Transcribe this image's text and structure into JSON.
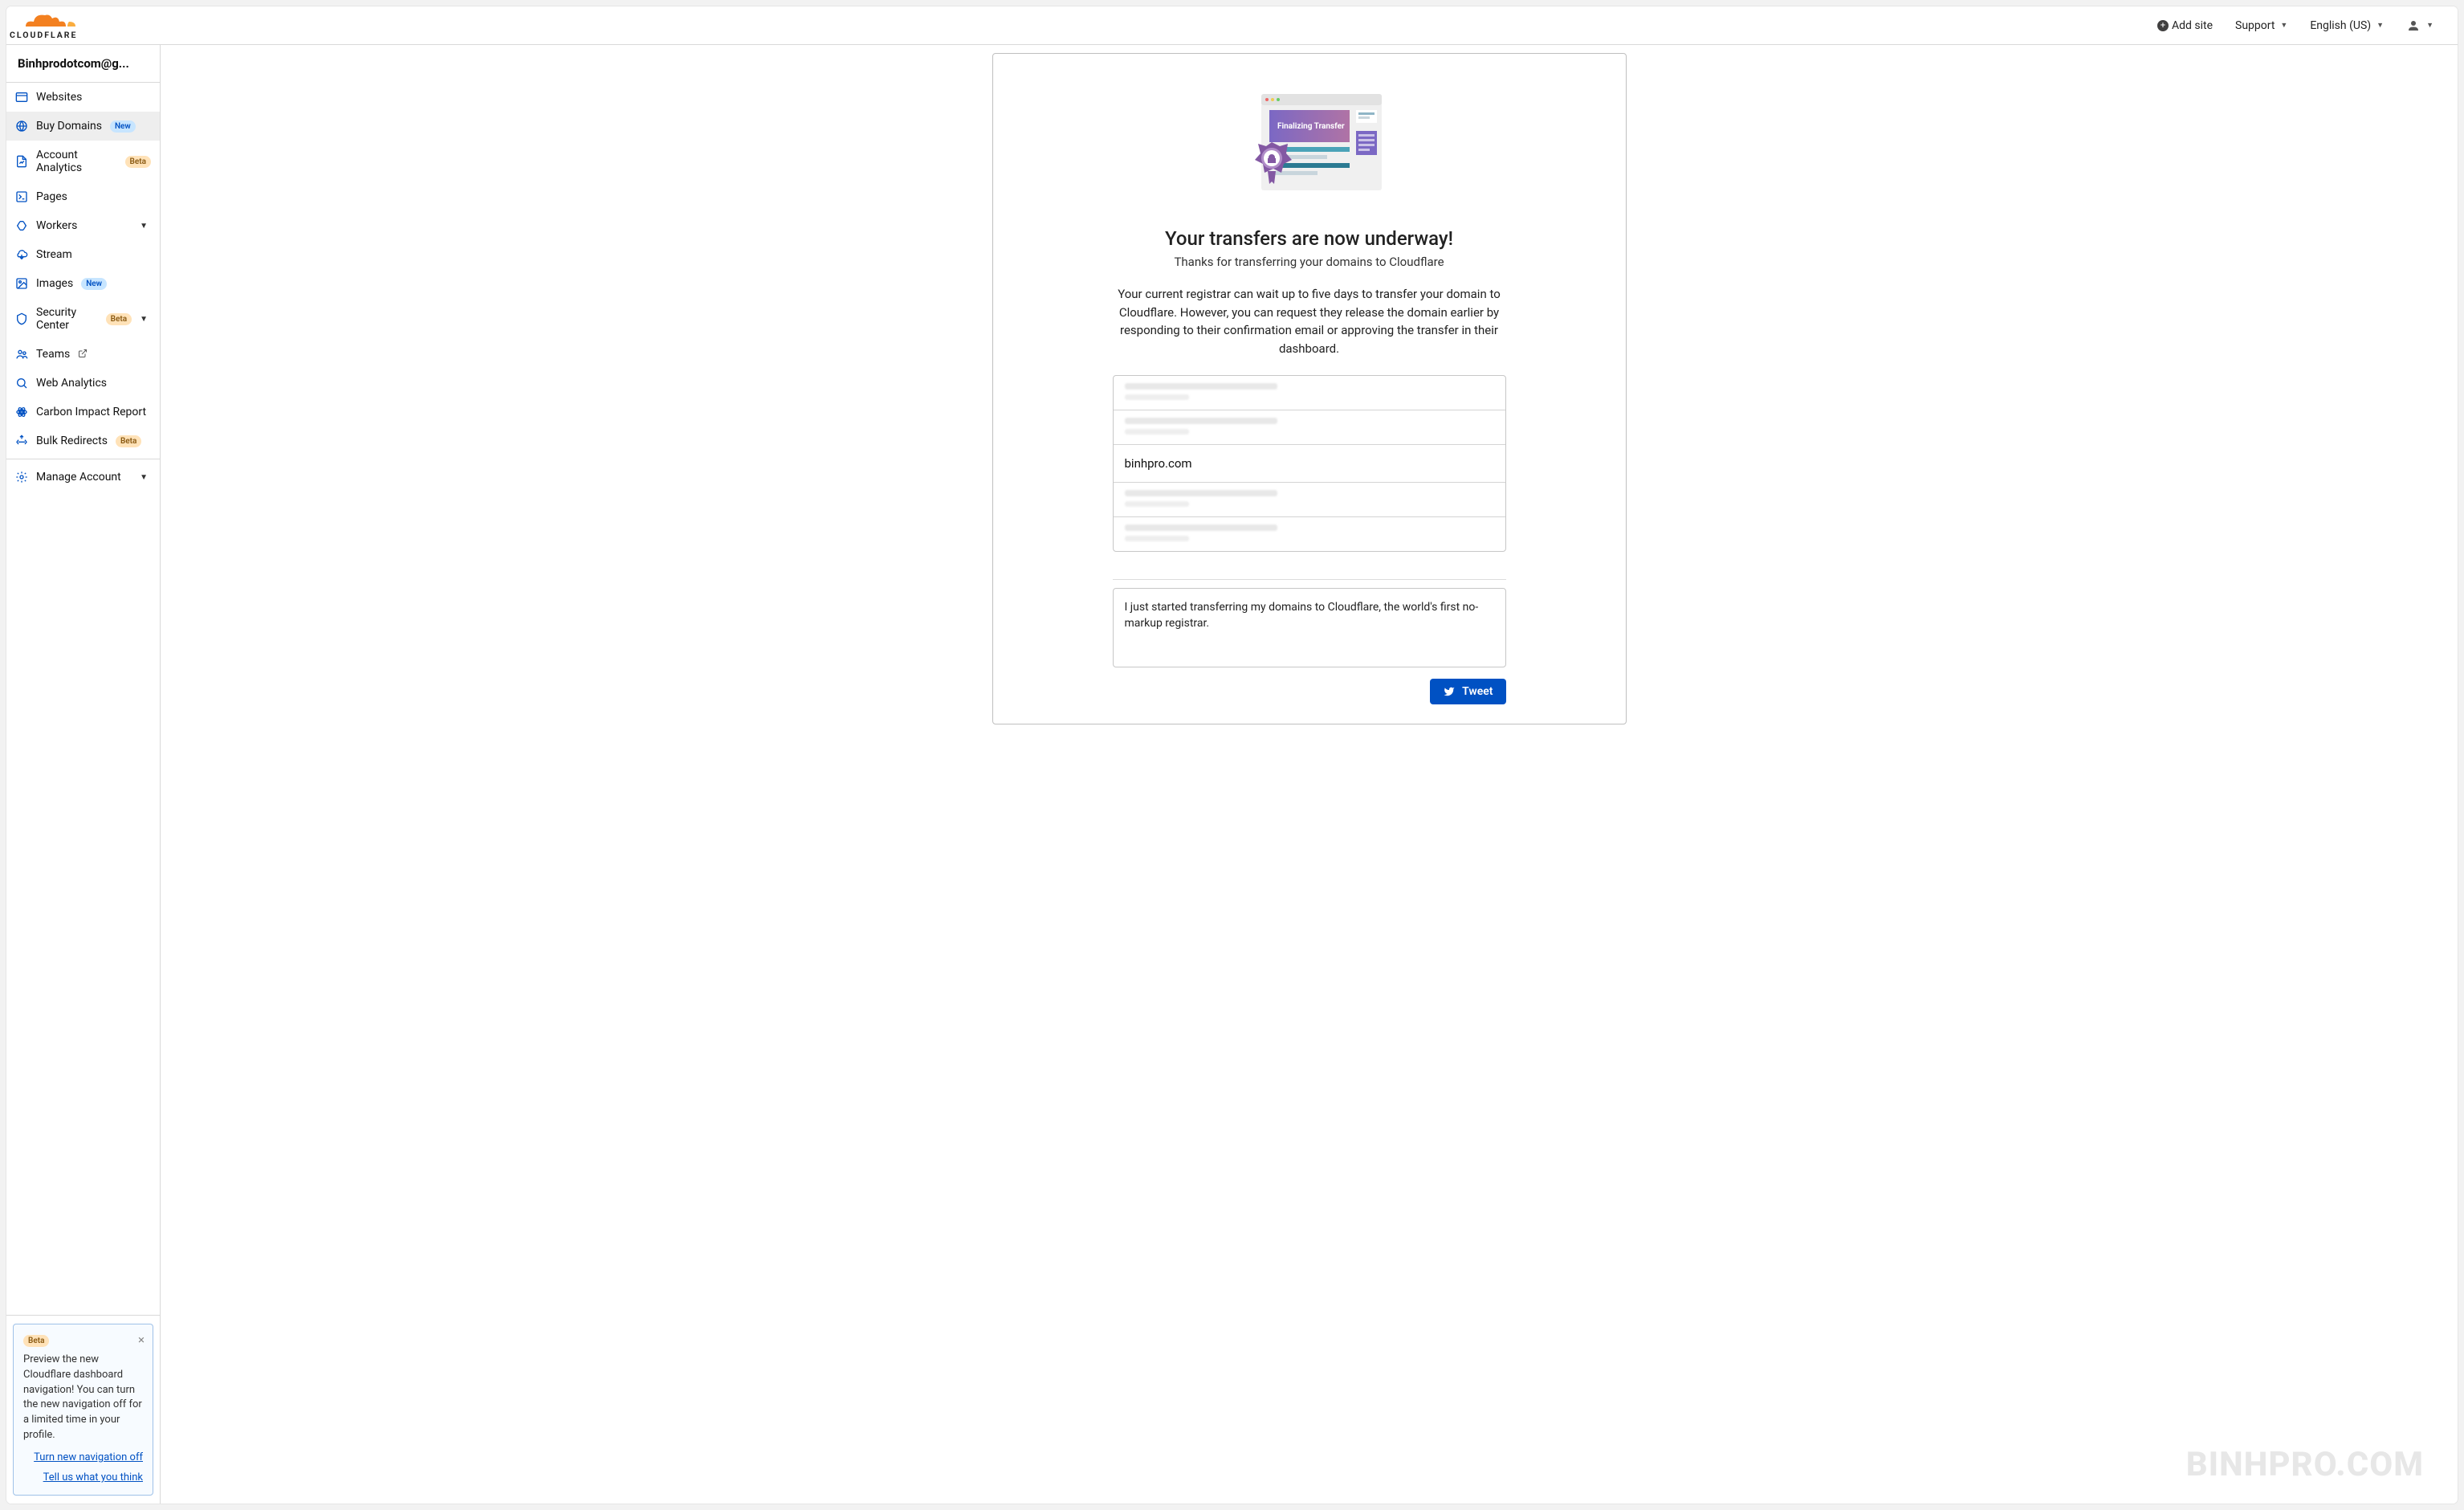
{
  "topbar": {
    "addSite": "Add site",
    "support": "Support",
    "language": "English (US)"
  },
  "sidebar": {
    "account": "Binhprodotcom@g...",
    "items": [
      {
        "label": "Websites",
        "icon": "websites-icon"
      },
      {
        "label": "Buy Domains",
        "icon": "globe-icon",
        "badge": "New",
        "active": true
      },
      {
        "label": "Account Analytics",
        "icon": "analytics-icon",
        "badge": "Beta"
      },
      {
        "label": "Pages",
        "icon": "pages-icon"
      },
      {
        "label": "Workers",
        "icon": "workers-icon",
        "chevron": true
      },
      {
        "label": "Stream",
        "icon": "cloud-icon"
      },
      {
        "label": "Images",
        "icon": "image-icon",
        "badge": "New"
      },
      {
        "label": "Security Center",
        "icon": "shield-icon",
        "badge": "Beta",
        "chevron": true
      },
      {
        "label": "Teams",
        "icon": "teams-icon",
        "external": true
      },
      {
        "label": "Web Analytics",
        "icon": "search-icon"
      },
      {
        "label": "Carbon Impact Report",
        "icon": "atom-icon"
      },
      {
        "label": "Bulk Redirects",
        "icon": "redirect-icon",
        "badge": "Beta"
      },
      {
        "label": "Manage Account",
        "icon": "gear-icon",
        "chevron": true
      }
    ]
  },
  "previewCard": {
    "badge": "Beta",
    "text": "Preview the new Cloudflare dashboard navigation! You can turn the new navigation off for a limited time in your profile.",
    "link1": "Turn new navigation off",
    "link2": "Tell us what you think"
  },
  "main": {
    "heading": "Your transfers are now underway!",
    "subhead": "Thanks for transferring your domains to Cloudflare",
    "para": "Your current registrar can wait up to five days to transfer your domain to Cloudflare. However, you can request they release the domain earlier by responding to their confirmation email or approving the transfer in their dashboard.",
    "domain": "binhpro.com",
    "tweetText": "I just started transferring my domains to Cloudflare, the world's first no-markup registrar.",
    "tweetBtn": "Tweet",
    "illusLabel": "Finalizing Transfer"
  },
  "watermark": "BINHPRO.COM"
}
